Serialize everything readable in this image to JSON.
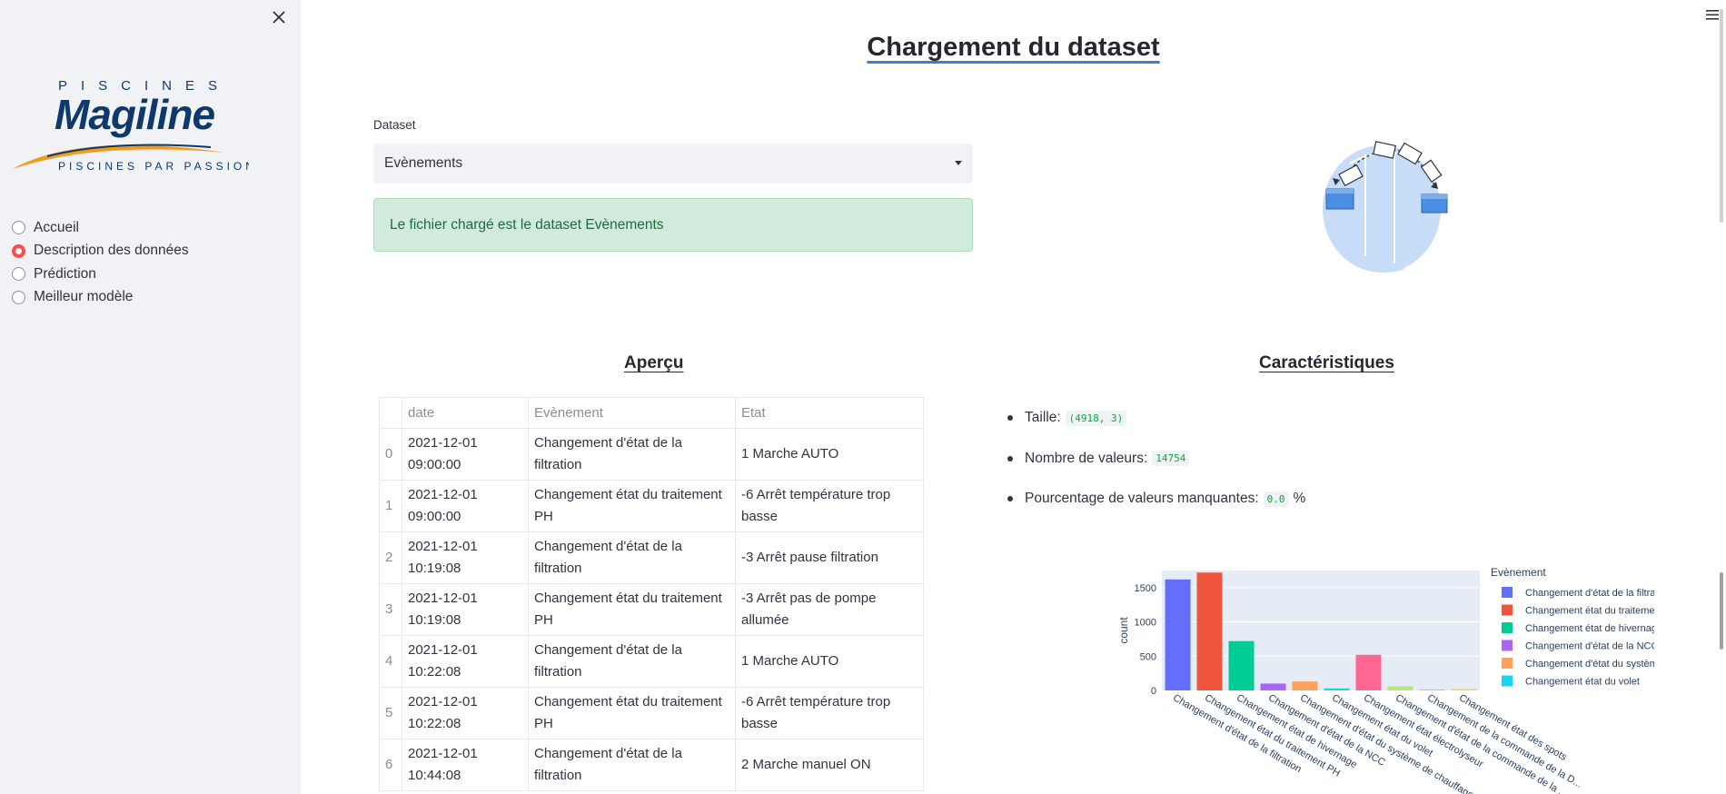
{
  "sidebar": {
    "logo_top": "PISCINES",
    "logo_brand": "Magiline",
    "logo_tagline": "PISCINES PAR PASSION",
    "nav": [
      {
        "label": "Accueil",
        "selected": false
      },
      {
        "label": "Description des données",
        "selected": true
      },
      {
        "label": "Prédiction",
        "selected": false
      },
      {
        "label": "Meilleur modèle",
        "selected": false
      }
    ]
  },
  "main": {
    "title": "Chargement du dataset",
    "dataset_label": "Dataset",
    "dataset_value": "Evènements",
    "success_message": "Le fichier chargé est le dataset Evènements",
    "apercu_title": "Aperçu",
    "caracteristiques_title": "Caractéristiques"
  },
  "table": {
    "headers": [
      "",
      "date",
      "Evènement",
      "Etat"
    ],
    "rows": [
      {
        "idx": "0",
        "date_line1": "2021-12-01",
        "date_line2": "09:00:00",
        "event": "Changement d'état de la filtration",
        "etat": "1 Marche AUTO"
      },
      {
        "idx": "1",
        "date_line1": "2021-12-01",
        "date_line2": "09:00:00",
        "event": "Changement état du traitement PH",
        "etat": "-6 Arrêt température trop basse"
      },
      {
        "idx": "2",
        "date_line1": "2021-12-01",
        "date_line2": "10:19:08",
        "event": "Changement d'état de la filtration",
        "etat": "-3 Arrêt pause filtration"
      },
      {
        "idx": "3",
        "date_line1": "2021-12-01",
        "date_line2": "10:19:08",
        "event": "Changement état du traitement PH",
        "etat": "-3 Arrêt pas de pompe allumée"
      },
      {
        "idx": "4",
        "date_line1": "2021-12-01",
        "date_line2": "10:22:08",
        "event": "Changement d'état de la filtration",
        "etat": "1 Marche AUTO"
      },
      {
        "idx": "5",
        "date_line1": "2021-12-01",
        "date_line2": "10:22:08",
        "event": "Changement état du traitement PH",
        "etat": "-6 Arrêt température trop basse"
      },
      {
        "idx": "6",
        "date_line1": "2021-12-01",
        "date_line2": "10:44:08",
        "event": "Changement d'état de la filtration",
        "etat": "2 Marche manuel ON"
      }
    ]
  },
  "characteristics": [
    {
      "label": "Taille:",
      "code": "(4918, 3)",
      "suffix": ""
    },
    {
      "label": "Nombre de valeurs:",
      "code": "14754",
      "suffix": ""
    },
    {
      "label": "Pourcentage de valeurs manquantes:",
      "code": "0.0",
      "suffix": "%"
    }
  ],
  "chart_data": {
    "type": "bar",
    "ylabel": "count",
    "legend_title": "Evènement",
    "legend_position": "right",
    "ylim": [
      0,
      1750
    ],
    "yticks": [
      0,
      500,
      1000,
      1500
    ],
    "categories": [
      "Changement d'état de la filtration",
      "Changement état du traitement PH",
      "Changement état de hivernage",
      "Changement d'état de la NCC",
      "Changement d'état du système de chauffage",
      "Changement état du volet",
      "Changement état électrolyseur",
      "Changement d'état de la commande de la pompe",
      "Changement de la commande de la D...",
      "Changement état des spots"
    ],
    "tick_labels": [
      "Changement d'état de la filtration",
      "Changement état du traitement PH",
      "Changement état de hivernage",
      "Changement d'état de la NCC",
      "Changement d'état du système de chauffage",
      "Changement état du volet",
      "Changement état électrolyseur",
      "Changement d'état de la commande de la ...",
      "Changement de la commande de la D...",
      "Changement état des spots"
    ],
    "values": [
      1620,
      1720,
      720,
      100,
      130,
      30,
      520,
      60,
      15,
      20
    ],
    "colors": [
      "#636efa",
      "#ef553b",
      "#00cc96",
      "#ab63fa",
      "#ffa15a",
      "#19d3f3",
      "#ff6692",
      "#b6e880",
      "#ff97ff",
      "#fecb52"
    ],
    "legend": [
      {
        "name": "Changement d'état de la filtration",
        "color": "#636efa"
      },
      {
        "name": "Changement état du traitement PH",
        "color": "#ef553b"
      },
      {
        "name": "Changement état de hivernage",
        "color": "#00cc96"
      },
      {
        "name": "Changement d'état de la NCC",
        "color": "#ab63fa"
      },
      {
        "name": "Changement d'état du système de chauffage",
        "color": "#ffa15a"
      },
      {
        "name": "Changement état du volet",
        "color": "#19d3f3"
      }
    ]
  }
}
